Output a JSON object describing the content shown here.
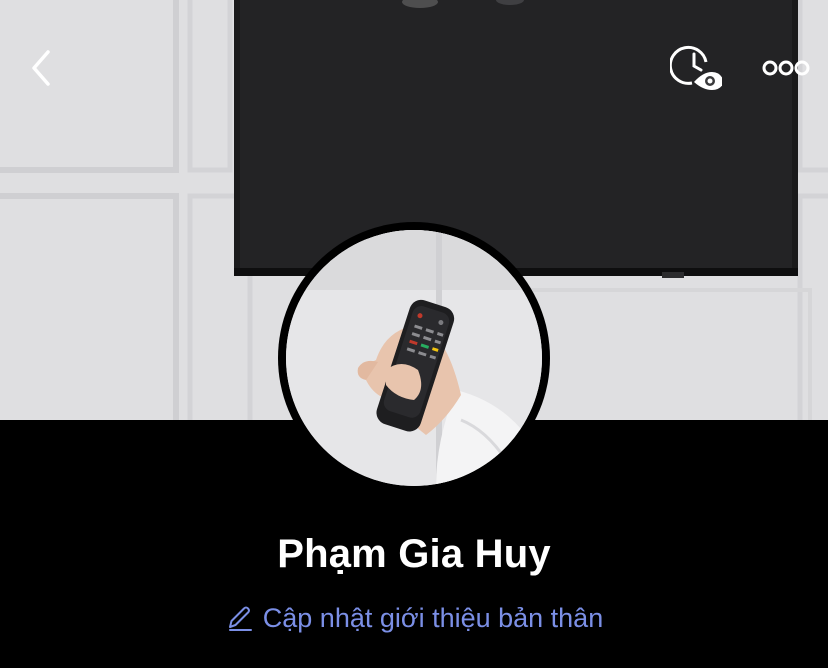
{
  "profile": {
    "name": "Phạm Gia Huy",
    "update_bio_label": "Cập nhật giới thiệu bản thân"
  },
  "icons": {
    "back": "chevron-left-icon",
    "story_archive": "clock-eye-icon",
    "more": "more-horizontal-icon",
    "edit": "pencil-icon"
  },
  "colors": {
    "background": "#000000",
    "name_text": "#ffffff",
    "link_text": "#7b8fe6",
    "avatar_ring": "#000000"
  }
}
